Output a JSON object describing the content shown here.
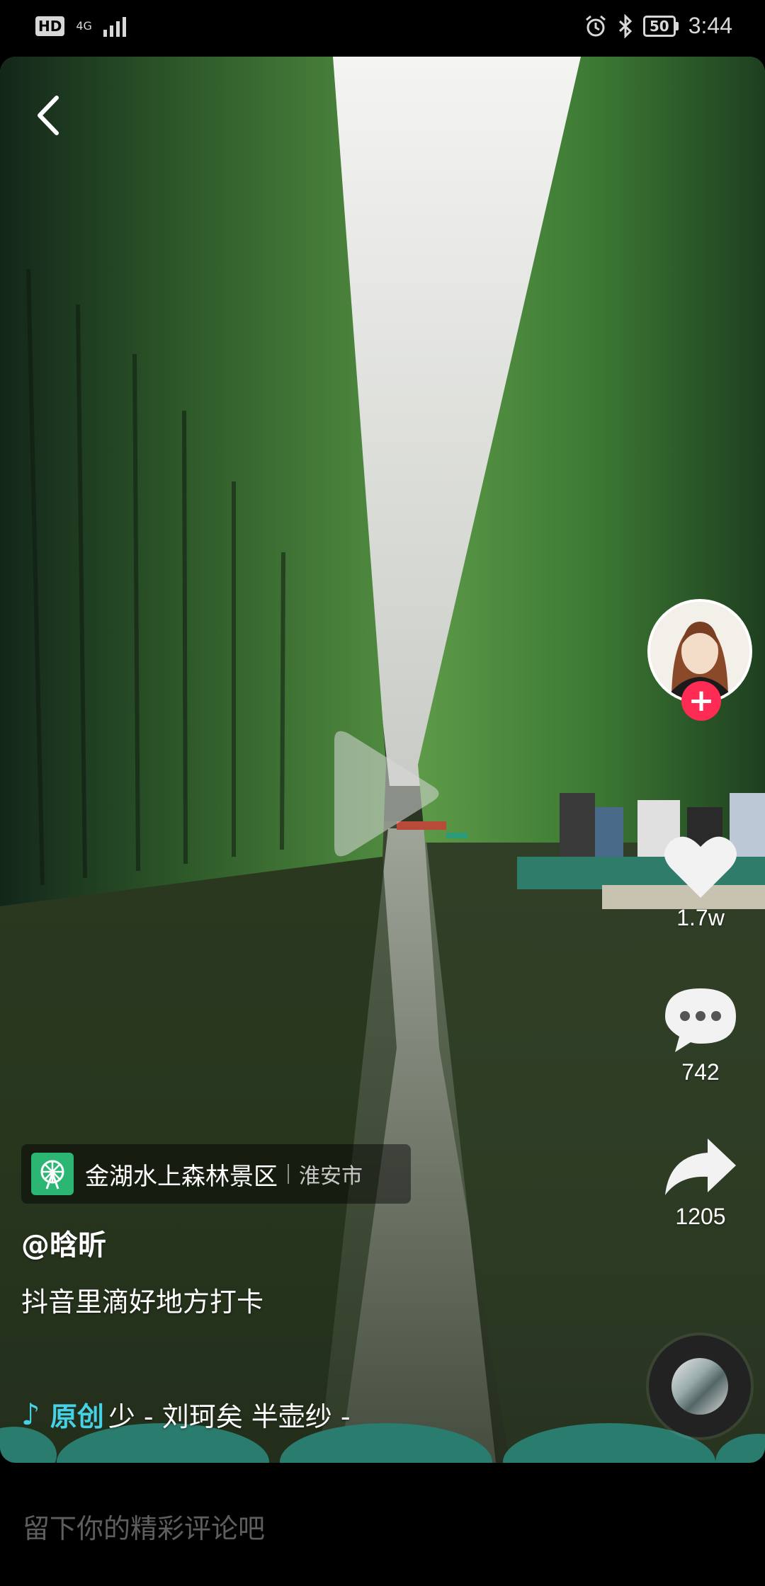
{
  "status_bar": {
    "hd_label": "HD",
    "network_label": "4G",
    "battery_level": "50",
    "time": "3:44",
    "icons": [
      "alarm-icon",
      "bluetooth-icon"
    ]
  },
  "video": {
    "location": {
      "name": "金湖水上森林景区",
      "city": "淮安市"
    },
    "author": "@晗昕",
    "caption": "抖音里滴好地方打卡",
    "music": {
      "original_label": "原创",
      "track": "少 - 刘珂矣  半壶纱 -"
    },
    "actions": {
      "likes": "1.7w",
      "comments": "742",
      "shares": "1205"
    }
  },
  "comment_input": {
    "placeholder": "留下你的精彩评论吧"
  },
  "colors": {
    "follow_red": "#fe2c55",
    "music_accent": "#45d1e6",
    "location_green": "#2bb673"
  }
}
